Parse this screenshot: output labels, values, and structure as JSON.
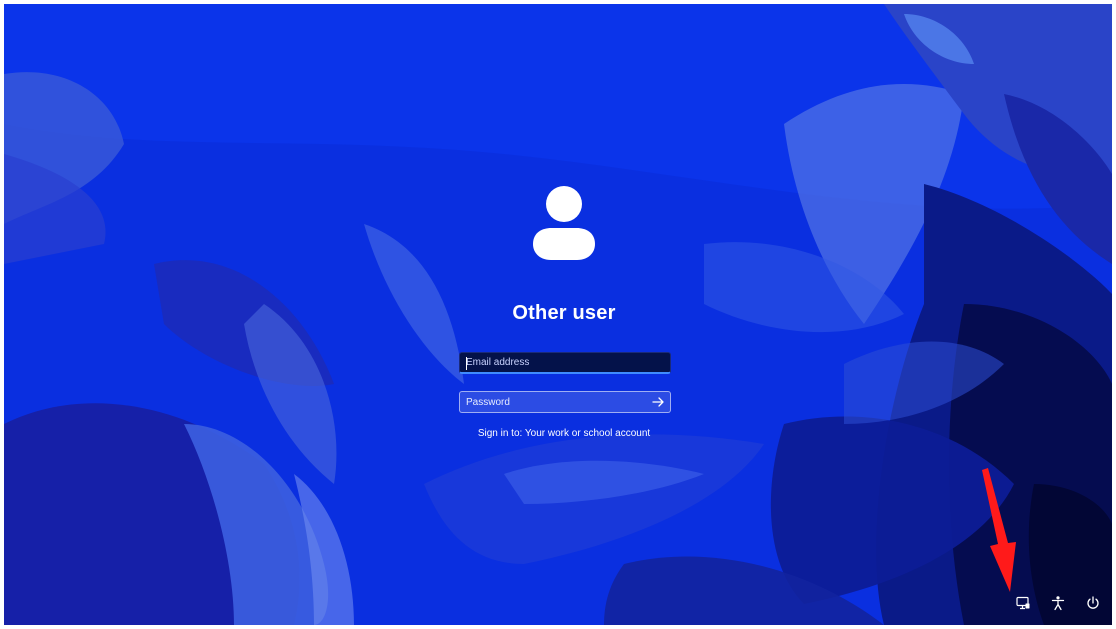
{
  "user": {
    "display_name": "Other user"
  },
  "email": {
    "placeholder": "Email address"
  },
  "password": {
    "placeholder": "Password"
  },
  "sign_in_to": "Sign in to: Your work or school account",
  "tray": {
    "icons": [
      "network-icon",
      "accessibility-icon",
      "power-icon"
    ]
  },
  "colors": {
    "wallpaper_base": "#0a2fe0",
    "focus_accent": "#3f8cff",
    "annotation_arrow": "#ff1a1a"
  }
}
